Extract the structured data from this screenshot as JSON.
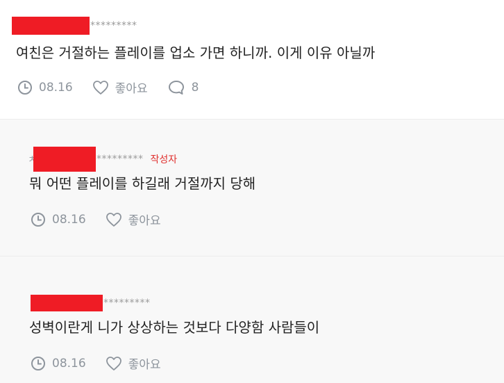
{
  "comments": [
    {
      "author_masked": "*********",
      "text": "여친은 거절하는 플레이를 업소 가면 하니까. 이게 이유 아닐까",
      "date": "08.16",
      "like_label": "좋아요",
      "reply_count": "8"
    },
    {
      "author_prefix": "ㅊ",
      "author_masked": "*********",
      "writer_badge": "작성자",
      "text": "뭐 어떤 플레이를 하길래 거절까지 당해",
      "date": "08.16",
      "like_label": "좋아요"
    },
    {
      "author_prefix": "",
      "author_masked": "*********",
      "text": "성벽이란게 니가 상상하는 것보다 다양함 사람들이",
      "date": "08.16",
      "like_label": "좋아요"
    }
  ],
  "colors": {
    "mask": "#ef1c25",
    "badge": "#e0312f",
    "meta": "#8d949c",
    "reply_bg": "#f8f8f8"
  },
  "icons": [
    "clock-icon",
    "heart-icon",
    "comment-bubble-icon"
  ]
}
